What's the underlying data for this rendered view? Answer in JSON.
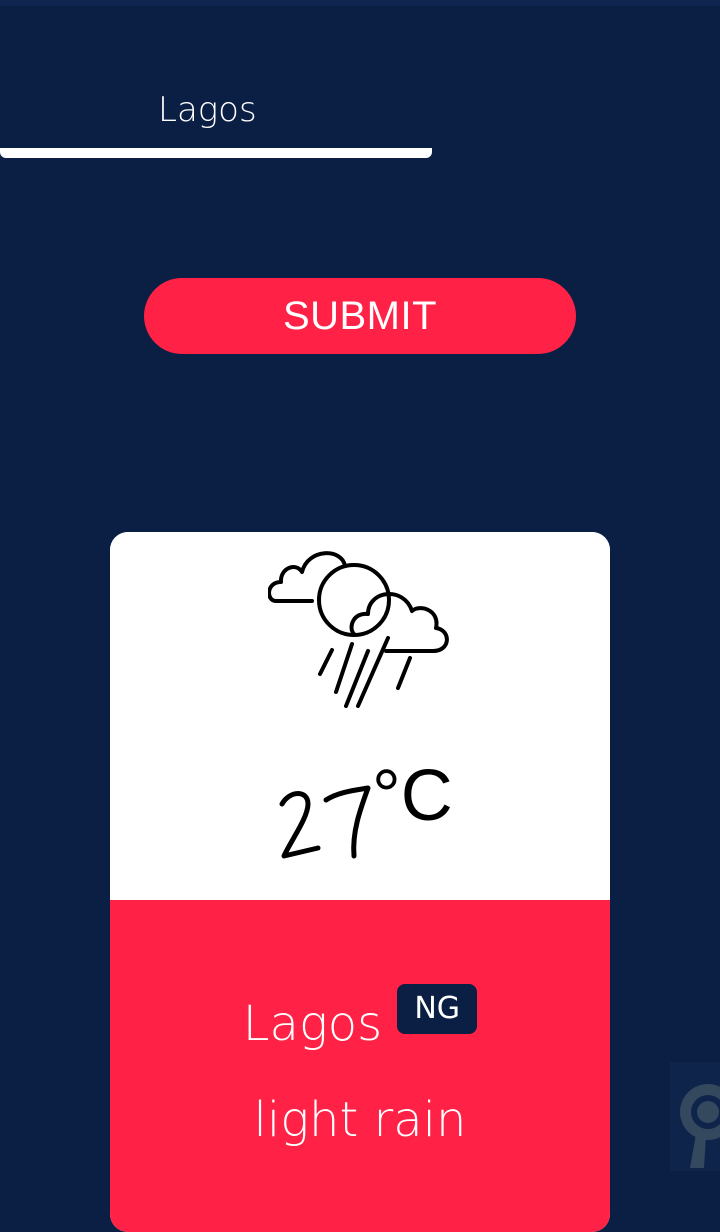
{
  "search": {
    "value": "Lagos"
  },
  "submit": {
    "label": "SUBMIT"
  },
  "weather": {
    "icon": "cloud-sun-rain-icon",
    "temperature": "27",
    "unit": "°C",
    "city": "Lagos",
    "country": "NG",
    "description": "light rain"
  },
  "colors": {
    "background": "#0b1f45",
    "accent": "#ff2146",
    "card": "#ffffff"
  }
}
